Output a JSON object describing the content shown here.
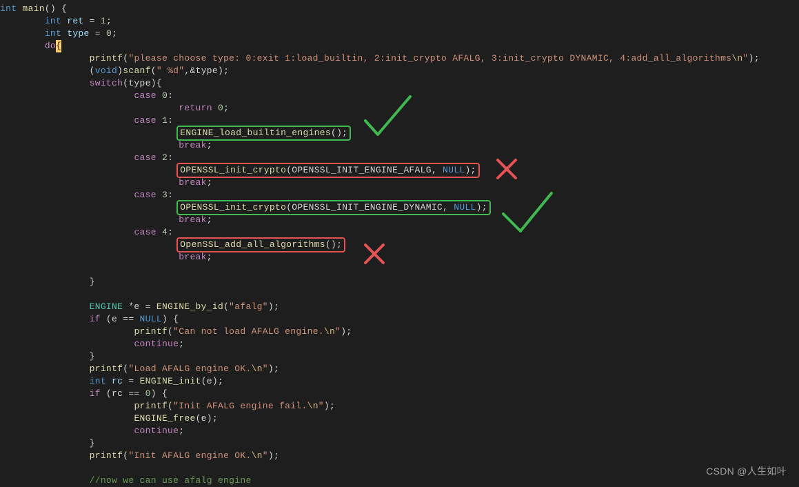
{
  "code": {
    "line1": {
      "kw": "int",
      "fn": "main",
      "rest": "() {"
    },
    "line2": {
      "kw": "int",
      "id": "ret",
      "op": " = ",
      "num": "1",
      "end": ";"
    },
    "line3": {
      "kw": "int",
      "id": "type",
      "op": " = ",
      "num": "0",
      "end": ";"
    },
    "line4": {
      "kw": "do",
      "brace": "{"
    },
    "line5": {
      "fn": "printf",
      "open": "(",
      "str": "\"please choose type: 0:exit 1:load_builtin, 2:init_crypto AFALG, 3:init_crypto DYNAMIC, 4:add_all_algorithms",
      "esc": "\\n",
      "strend": "\"",
      "close": ");"
    },
    "line6": {
      "cast_open": "(",
      "kw": "void",
      "cast_close": ")",
      "fn": "scanf",
      "open": "(",
      "str": "\" %d\"",
      "rest": ",&type);"
    },
    "line7": {
      "kw": "switch",
      "rest": "(type){"
    },
    "case0": {
      "kw": "case",
      "num": "0",
      "colon": ":"
    },
    "return0": {
      "kw": "return",
      "num": "0",
      "end": ";"
    },
    "case1": {
      "kw": "case",
      "num": "1",
      "colon": ":"
    },
    "stmt1": {
      "fn": "ENGINE_load_builtin_engines",
      "rest": "();"
    },
    "break1": {
      "kw": "break",
      "end": ";"
    },
    "case2": {
      "kw": "case",
      "num": "2",
      "colon": ":"
    },
    "stmt2": {
      "fn": "OPENSSL_init_crypto",
      "open": "(",
      "arg1": "OPENSSL_INIT_ENGINE_AFALG",
      "comma": ", ",
      "nul": "NULL",
      "close": ");"
    },
    "break2": {
      "kw": "break",
      "end": ";"
    },
    "case3": {
      "kw": "case",
      "num": "3",
      "colon": ":"
    },
    "stmt3": {
      "fn": "OPENSSL_init_crypto",
      "open": "(",
      "arg1": "OPENSSL_INIT_ENGINE_DYNAMIC",
      "comma": ", ",
      "nul": "NULL",
      "close": ");"
    },
    "break3": {
      "kw": "break",
      "end": ";"
    },
    "case4": {
      "kw": "case",
      "num": "4",
      "colon": ":"
    },
    "stmt4": {
      "fn": "OpenSSL_add_all_algorithms",
      "rest": "();"
    },
    "break4": {
      "kw": "break",
      "end": ";"
    },
    "switch_close": "}",
    "engine_decl": {
      "typ": "ENGINE",
      "rest1": " *e = ",
      "fn": "ENGINE_by_id",
      "open": "(",
      "str": "\"afalg\"",
      "close": ");"
    },
    "if_null": {
      "kw": "if",
      "open": " (e == ",
      "nul": "NULL",
      "close": ") {"
    },
    "printf_noload": {
      "fn": "printf",
      "open": "(",
      "str": "\"Can not load AFALG engine.",
      "esc": "\\n",
      "strend": "\"",
      "close": ");"
    },
    "continue1": {
      "kw": "continue",
      "end": ";"
    },
    "brace_close1": "}",
    "printf_loadok": {
      "fn": "printf",
      "open": "(",
      "str": "\"Load AFALG engine OK.",
      "esc": "\\n",
      "strend": "\"",
      "close": ");"
    },
    "rc_decl": {
      "kw": "int",
      "id": "rc",
      "op": " = ",
      "fn": "ENGINE_init",
      "rest": "(e);"
    },
    "if_rc": {
      "kw": "if",
      "open": " (rc == ",
      "num": "0",
      "close": ") {"
    },
    "printf_initfail": {
      "fn": "printf",
      "open": "(",
      "str": "\"Init AFALG engine fail.",
      "esc": "\\n",
      "strend": "\"",
      "close": ");"
    },
    "engine_free": {
      "fn": "ENGINE_free",
      "rest": "(e);"
    },
    "continue2": {
      "kw": "continue",
      "end": ";"
    },
    "brace_close2": "}",
    "printf_initok": {
      "fn": "printf",
      "open": "(",
      "str": "\"Init AFALG engine OK.",
      "esc": "\\n",
      "strend": "\"",
      "close": ");"
    },
    "comment": "//now we can use afalg engine"
  },
  "watermark": "CSDN @人生如叶",
  "annotations": {
    "check1": {
      "type": "check",
      "color": "#3fb950"
    },
    "cross1": {
      "type": "cross",
      "color": "#e55353"
    },
    "check2": {
      "type": "check",
      "color": "#3fb950"
    },
    "cross2": {
      "type": "cross",
      "color": "#e55353"
    }
  }
}
